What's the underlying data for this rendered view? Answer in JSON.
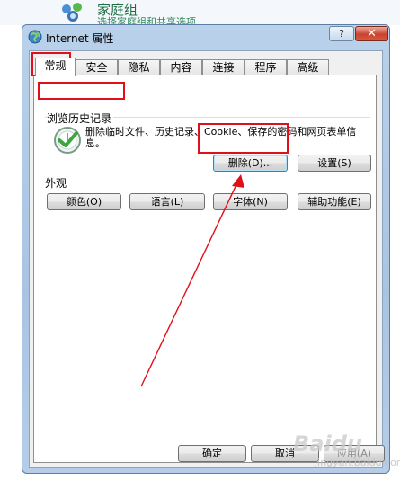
{
  "background": {
    "title": "家庭组",
    "subtitle": "选择家庭组和共享选项"
  },
  "window": {
    "title": "Internet 属性",
    "help_label": "?",
    "close_label": "✕"
  },
  "tabs": [
    {
      "label": "常规",
      "active": true
    },
    {
      "label": "安全"
    },
    {
      "label": "隐私"
    },
    {
      "label": "内容"
    },
    {
      "label": "连接"
    },
    {
      "label": "程序"
    },
    {
      "label": "高级"
    }
  ],
  "history": {
    "group_title": "浏览历史记录",
    "description": "删除临时文件、历史记录、Cookie、保存的密码和网页表单信息。",
    "delete_label": "删除(D)...",
    "settings_label": "设置(S)"
  },
  "appearance": {
    "group_title": "外观",
    "colors_label": "颜色(O)",
    "languages_label": "语言(L)",
    "fonts_label": "字体(N)",
    "accessibility_label": "辅助功能(E)"
  },
  "footer": {
    "ok_label": "确定",
    "cancel_label": "取消",
    "apply_label": "应用(A)"
  },
  "watermark": {
    "text": "Baidu",
    "sub": "jingyan.baidu.com"
  },
  "colors": {
    "annotation": "#e0101a",
    "window_frame": "#b9d1ea"
  }
}
